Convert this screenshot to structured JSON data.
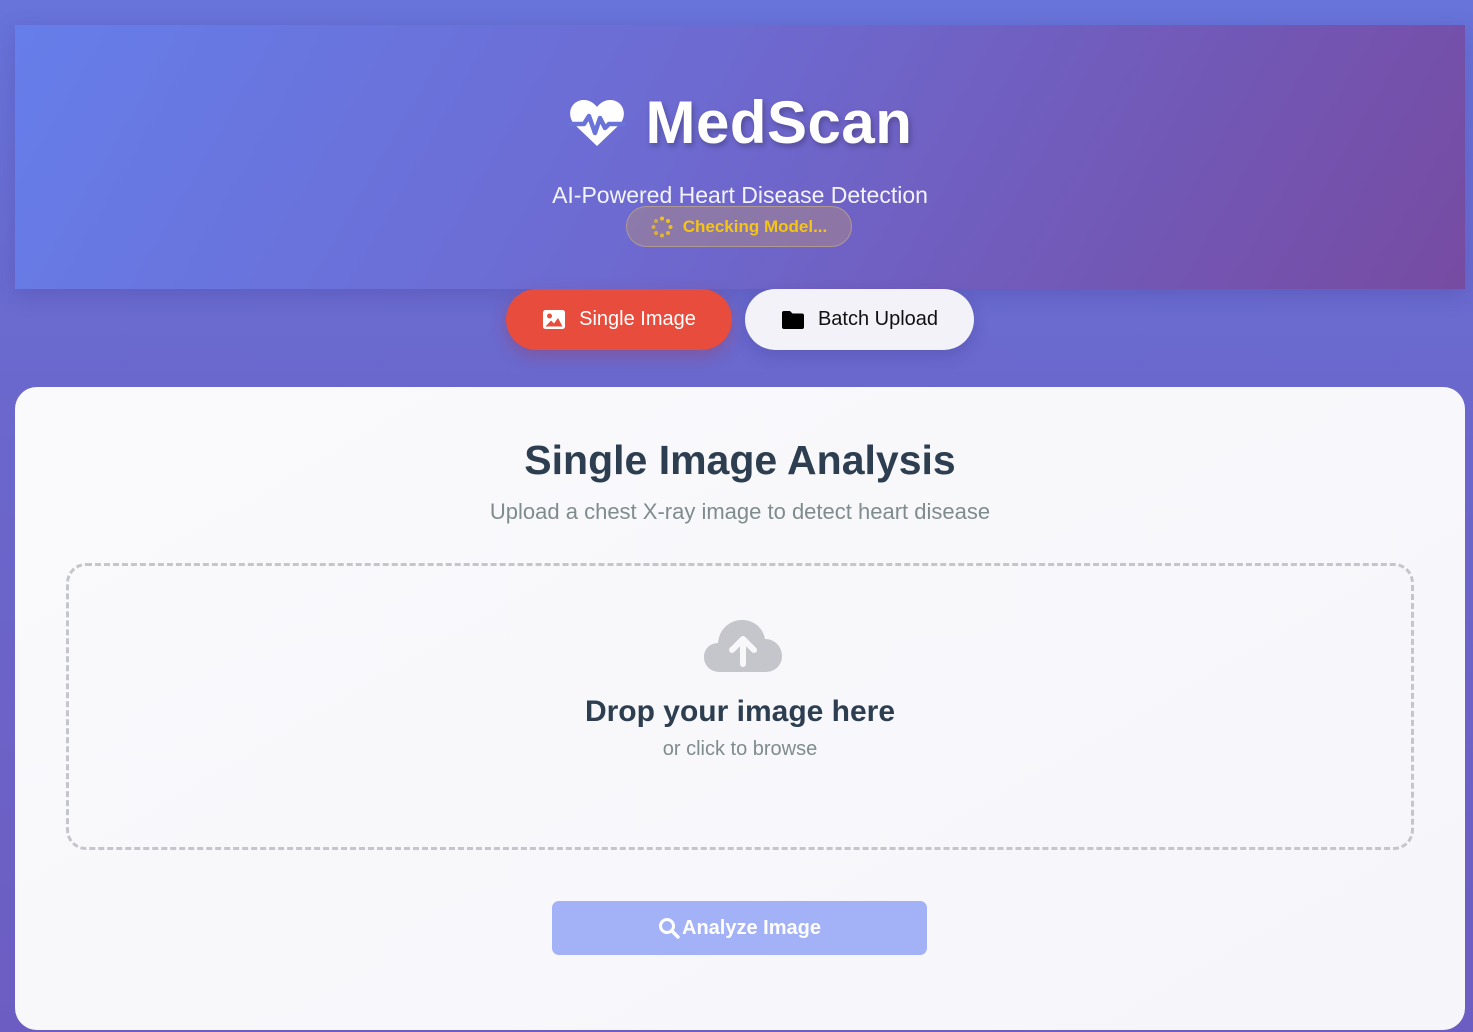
{
  "header": {
    "app_title": "MedScan",
    "subtitle": "AI-Powered Heart Disease Detection",
    "model_status": "Checking Model...",
    "logo_icon": "heartbeat-icon",
    "status_icon": "spinner-icon"
  },
  "tabs": [
    {
      "label": "Single Image",
      "icon": "image-icon",
      "active": true
    },
    {
      "label": "Batch Upload",
      "icon": "folder-icon",
      "active": false
    }
  ],
  "main": {
    "title": "Single Image Analysis",
    "subtitle": "Upload a chest X-ray image to detect heart disease",
    "dropzone": {
      "icon": "cloud-upload-icon",
      "title": "Drop your image here",
      "subtitle": "or click to browse"
    },
    "analyze_button": {
      "label": "Analyze Image",
      "icon": "search-icon",
      "disabled": true
    }
  },
  "colors": {
    "accent_active_tab": "#e74c3c",
    "status_text": "#f5c414",
    "analyze_button_disabled": "#a3b1f7",
    "heading_text": "#2c3e50",
    "muted_text": "#7f8c8d"
  }
}
